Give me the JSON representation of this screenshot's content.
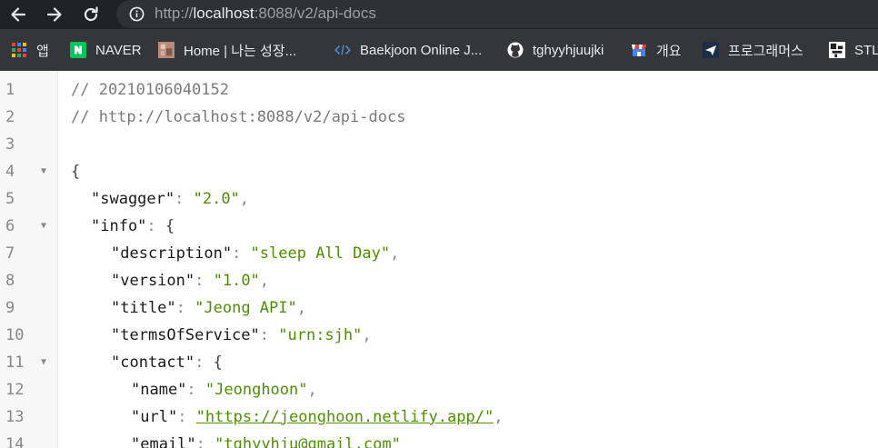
{
  "browser": {
    "url_scheme": "http://",
    "url_host": "localhost",
    "url_rest": ":8088/v2/api-docs",
    "nav_icons": [
      "back-icon",
      "forward-icon",
      "reload-icon",
      "info-icon"
    ]
  },
  "bookmarks": [
    {
      "label": "앱",
      "icon": "apps-grid-icon"
    },
    {
      "label": "NAVER",
      "icon": "naver-icon"
    },
    {
      "label": "Home | 나는 성장...",
      "icon": "blog-avatar-icon"
    },
    {
      "label": "Baekjoon Online J...",
      "icon": "code-brackets-icon"
    },
    {
      "label": "tghyyhjuujki",
      "icon": "github-icon"
    },
    {
      "label": "개요",
      "icon": "store-icon"
    },
    {
      "label": "프로그래머스",
      "icon": "programmers-icon"
    },
    {
      "label": "STL",
      "icon": "bookmark-avatar-icon"
    }
  ],
  "code": {
    "lines": [
      {
        "num": "1",
        "fold": "",
        "comment": "// 20210106040152"
      },
      {
        "num": "2",
        "fold": "",
        "comment": "// http://localhost:8088/v2/api-docs"
      },
      {
        "num": "3",
        "fold": ""
      },
      {
        "num": "4",
        "fold": "▼",
        "open": "{"
      },
      {
        "num": "5",
        "fold": "",
        "key": "\"swagger\"",
        "sep": ": ",
        "value": "\"2.0\"",
        "end": ","
      },
      {
        "num": "6",
        "fold": "▼",
        "key": "\"info\"",
        "sep": ": ",
        "open": "{"
      },
      {
        "num": "7",
        "fold": "",
        "key": "\"description\"",
        "sep": ": ",
        "value": "\"sleep All Day\"",
        "end": ","
      },
      {
        "num": "8",
        "fold": "",
        "key": "\"version\"",
        "sep": ": ",
        "value": "\"1.0\"",
        "end": ","
      },
      {
        "num": "9",
        "fold": "",
        "key": "\"title\"",
        "sep": ": ",
        "value": "\"Jeong API\"",
        "end": ","
      },
      {
        "num": "10",
        "fold": "",
        "key": "\"termsOfService\"",
        "sep": ": ",
        "value": "\"urn:sjh\"",
        "end": ","
      },
      {
        "num": "11",
        "fold": "▼",
        "key": "\"contact\"",
        "sep": ": ",
        "open": "{"
      },
      {
        "num": "12",
        "fold": "",
        "key": "\"name\"",
        "sep": ": ",
        "value": "\"Jeonghoon\"",
        "end": ","
      },
      {
        "num": "13",
        "fold": "",
        "key": "\"url\"",
        "sep": ": ",
        "link": "\"https://jeonghoon.netlify.app/\"",
        "end": ","
      },
      {
        "num": "14",
        "fold": "",
        "key": "\"email\"",
        "sep": ": ",
        "value": "\"tghyyhju@gmail.com\"",
        "end": ""
      }
    ]
  }
}
